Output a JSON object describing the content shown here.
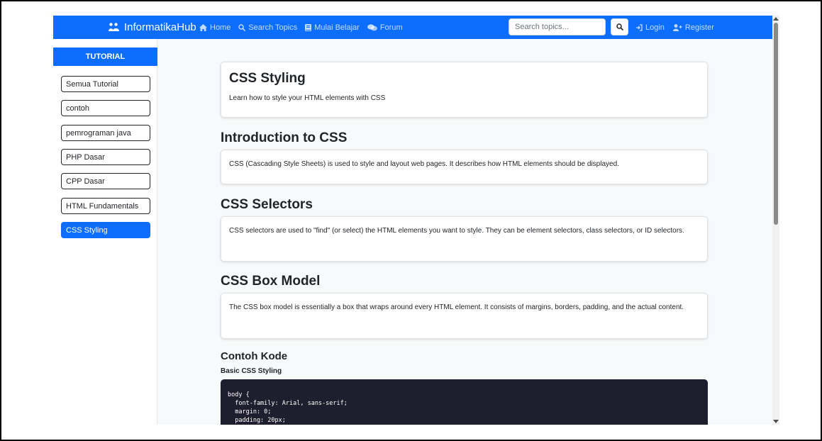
{
  "navbar": {
    "brand": "InformatikaHub",
    "links": [
      {
        "label": "Home",
        "icon": "home-icon"
      },
      {
        "label": "Search Topics",
        "icon": "search-icon"
      },
      {
        "label": "Mulai Belajar",
        "icon": "book-icon"
      },
      {
        "label": "Forum",
        "icon": "comments-icon"
      }
    ],
    "search": {
      "placeholder": "Search topics...",
      "value": ""
    },
    "login_label": "Login",
    "register_label": "Register"
  },
  "sidebar": {
    "header": "TUTORIAL",
    "items": [
      {
        "label": "Semua Tutorial",
        "active": false
      },
      {
        "label": "contoh",
        "active": false
      },
      {
        "label": "pemrograman java",
        "active": false
      },
      {
        "label": "PHP Dasar",
        "active": false
      },
      {
        "label": "CPP Dasar",
        "active": false
      },
      {
        "label": "HTML Fundamentals",
        "active": false
      },
      {
        "label": "CSS Styling",
        "active": true
      }
    ]
  },
  "main": {
    "title": "CSS Styling",
    "subtitle": "Learn how to style your HTML elements with CSS",
    "sections": [
      {
        "heading": "Introduction to CSS",
        "body": "CSS (Cascading Style Sheets) is used to style and layout web pages. It describes how HTML elements should be displayed."
      },
      {
        "heading": "CSS Selectors",
        "body": "CSS selectors are used to \"find\" (or select) the HTML elements you want to style. They can be element selectors, class selectors, or ID selectors."
      },
      {
        "heading": "CSS Box Model",
        "body": "The CSS box model is essentially a box that wraps around every HTML element. It consists of margins, borders, padding, and the actual content."
      }
    ],
    "code_heading": "Contoh Kode",
    "code_title": "Basic CSS Styling",
    "code_lines": [
      "body {",
      "  font-family: Arial, sans-serif;",
      "  margin: 0;",
      "  padding: 20px;"
    ]
  },
  "colors": {
    "primary": "#0d6efd",
    "code_bg": "#1e1e2e"
  }
}
